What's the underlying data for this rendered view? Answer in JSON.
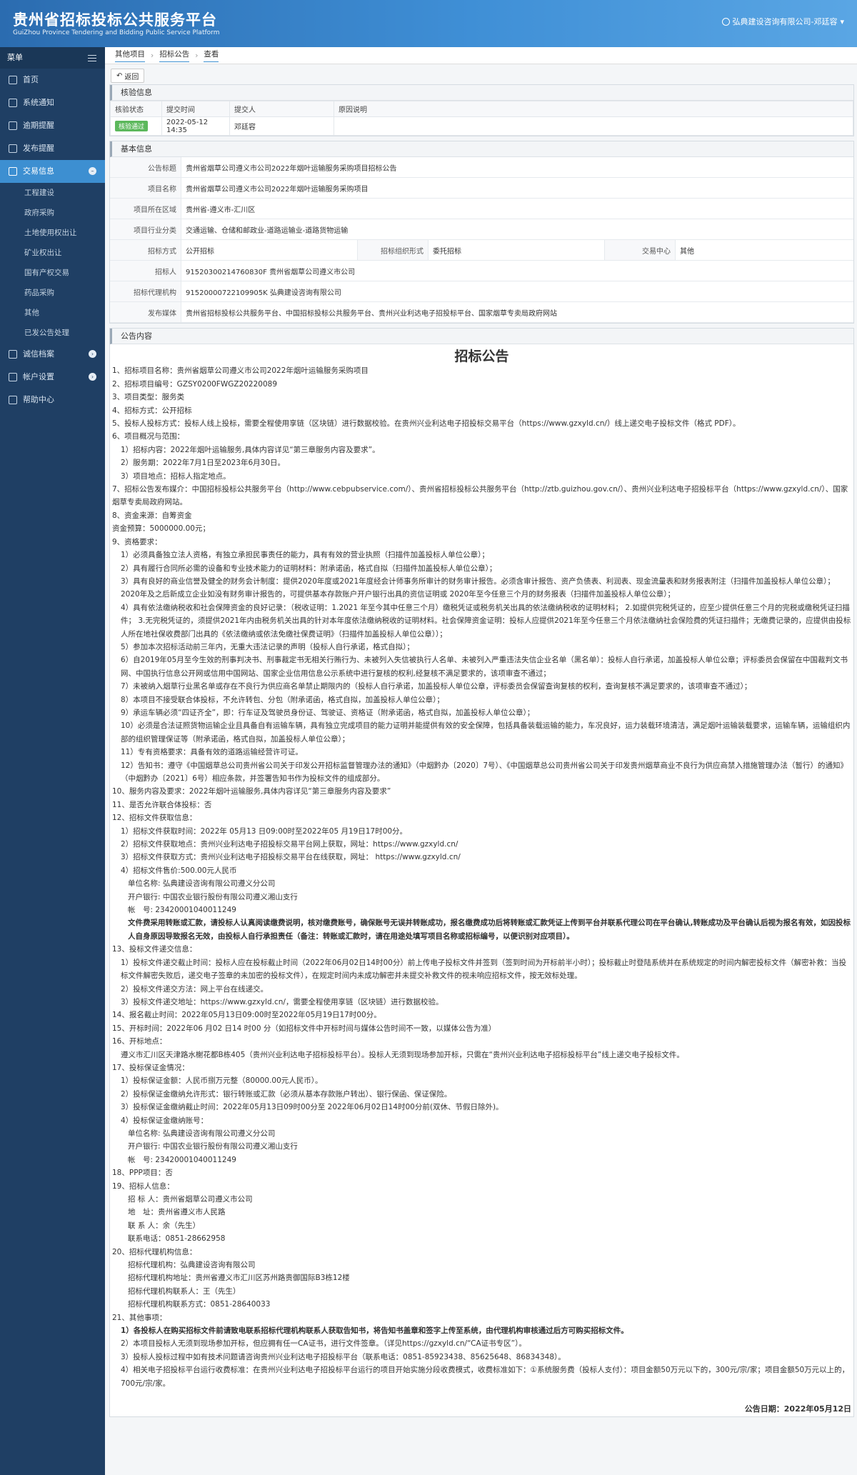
{
  "header": {
    "title": "贵州省招标投标公共服务平台",
    "subtitle": "GuiZhou Province Tendering and Bidding Public Service Platform",
    "user": "弘典建设咨询有限公司-邓廷容"
  },
  "sidebar": {
    "menu_label": "菜单",
    "items": [
      {
        "label": "首页",
        "icon": "home-icon"
      },
      {
        "label": "系统通知",
        "icon": "monitor-icon"
      },
      {
        "label": "逾期提醒",
        "icon": "calendar-icon"
      },
      {
        "label": "发布提醒",
        "icon": "calendar-icon"
      },
      {
        "label": "交易信息",
        "icon": "calendar-icon"
      }
    ],
    "subitems": [
      "工程建设",
      "政府采购",
      "土地使用权出让",
      "矿业权出让",
      "国有产权交易",
      "药品采购",
      "其他",
      "已发公告处理"
    ],
    "bottom": [
      {
        "label": "诚信档案"
      },
      {
        "label": "帐户设置"
      },
      {
        "label": "帮助中心"
      }
    ]
  },
  "breadcrumb": [
    "其他项目",
    "招标公告",
    "查看"
  ],
  "back_label": "返回",
  "check": {
    "title": "核验信息",
    "headers": [
      "核验状态",
      "提交时间",
      "提交人",
      "原因说明"
    ],
    "status": "核验通过",
    "time": "2022-05-12 14:35",
    "person": "邓廷容",
    "reason": ""
  },
  "basic": {
    "title": "基本信息",
    "rows": [
      {
        "label": "公告标题",
        "value": "贵州省烟草公司遵义市公司2022年烟叶运输服务采购项目招标公告"
      },
      {
        "label": "项目名称",
        "value": "贵州省烟草公司遵义市公司2022年烟叶运输服务采购项目"
      },
      {
        "label": "项目所在区域",
        "value": "贵州省-遵义市-汇川区"
      },
      {
        "label": "项目行业分类",
        "value": "交通运输、仓储和邮政业-道路运输业-道路货物运输"
      }
    ],
    "method_label": "招标方式",
    "method": "公开招标",
    "org_label": "招标组织形式",
    "org": "委托招标",
    "center_label": "交易中心",
    "center": "其他",
    "rows2": [
      {
        "label": "招标人",
        "value": "91520300214760830F 贵州省烟草公司遵义市公司"
      },
      {
        "label": "招标代理机构",
        "value": "91520000722109905K 弘典建设咨询有限公司"
      },
      {
        "label": "发布媒体",
        "value": "贵州省招标投标公共服务平台、中国招标投标公共服务平台、贵州兴业利达电子招投标平台、国家烟草专卖局政府网站"
      }
    ]
  },
  "content": {
    "title": "公告内容",
    "heading": "招标公告",
    "date": "公告日期：2022年05月12日"
  },
  "lines": [
    {
      "c": "",
      "t": "1、招标项目名称：贵州省烟草公司遵义市公司2022年烟叶运输服务采购项目"
    },
    {
      "c": "",
      "t": "2、招标项目编号：GZSY0200FWGZ20220089"
    },
    {
      "c": "",
      "t": "3、项目类型：服务类"
    },
    {
      "c": "",
      "t": "4、招标方式：公开招标"
    },
    {
      "c": "",
      "t": "5、投标人投标方式：投标人线上投标，需要全程使用享链（区块链）进行数据校验。在贵州兴业利达电子招投标交易平台（https://www.gzxyld.cn/）线上递交电子投标文件（格式 PDF）。"
    },
    {
      "c": "",
      "t": "6、项目概况与范围："
    },
    {
      "c": "ind1",
      "t": "1）招标内容：2022年烟叶运输服务,具体内容详见“第三章服务内容及要求”。"
    },
    {
      "c": "ind1",
      "t": "2）服务期：2022年7月1日至2023年6月30日。"
    },
    {
      "c": "ind1",
      "t": "3）项目地点：招标人指定地点。"
    },
    {
      "c": "",
      "t": "7、招标公告发布媒介：中国招标投标公共服务平台（http://www.cebpubservice.com/）、贵州省招标投标公共服务平台（http://ztb.guizhou.gov.cn/）、贵州兴业利达电子招投标平台（https://www.gzxyld.cn/）、国家烟草专卖局政府网站。"
    },
    {
      "c": "",
      "t": "8、资金来源：自筹资金"
    },
    {
      "c": "",
      "t": "资金预算：5000000.00元；"
    },
    {
      "c": "",
      "t": "9、资格要求："
    },
    {
      "c": "ind1",
      "t": "1）必须具备独立法人资格，有独立承担民事责任的能力，具有有效的营业执照（扫描件加盖投标人单位公章）；"
    },
    {
      "c": "ind1",
      "t": "2）具有履行合同所必需的设备和专业技术能力的证明材料：附承诺函，格式自拟（扫描件加盖投标人单位公章）；"
    },
    {
      "c": "ind1",
      "t": "3）具有良好的商业信誉及健全的财务会计制度：提供2020年度或2021年度经会计师事务所审计的财务审计报告。必须含审计报告、资产负债表、利润表、现金流量表和财务报表附注（扫描件加盖投标人单位公章）；2020年及之后新成立企业如没有财务审计报告的，可提供基本存款账户开户银行出具的资信证明或 2020年至今任意三个月的财务报表（扫描件加盖投标人单位公章）；"
    },
    {
      "c": "ind1",
      "t": "4）具有依法缴纳税收和社会保障资金的良好记录：（税收证明：1.2021 年至今其中任意三个月）缴税凭证或税务机关出具的依法缴纳税收的证明材料； 2.如提供完税凭证的，应至少提供任意三个月的完税或缴税凭证扫描件； 3.无完税凭证的，须提供2021年内由税务机关出具的针对本年度依法缴纳税收的证明材料。社会保障资金证明：投标人应提供2021年至今任意三个月依法缴纳社会保险费的凭证扫描件；无缴费记录的，应提供由投标人所在地社保收费部门出具的《依法缴纳或依法免缴社保费证明》（扫描件加盖投标人单位公章））；"
    },
    {
      "c": "ind1",
      "t": "5）参加本次招标活动前三年内，无重大违法记录的声明（投标人自行承诺，格式自拟）；"
    },
    {
      "c": "ind1",
      "t": "6）自2019年05月至今生效的刑事判决书、刑事裁定书无相关行贿行为、未被列入失信被执行人名单、未被列入严重违法失信企业名单（黑名单）：投标人自行承诺，加盖投标人单位公章；评标委员会保留在中国裁判文书网、中国执行信息公开网或信用中国网站、国家企业信用信息公示系统中进行复核的权利,经复核不满足要求的，该项审查不通过；"
    },
    {
      "c": "ind1",
      "t": "7）未被纳入烟草行业黑名单或存在不良行为供应商名单禁止期限内的（投标人自行承诺，加盖投标人单位公章，评标委员会保留查询复核的权利，查询复核不满足要求的，该项审查不通过）；"
    },
    {
      "c": "ind1",
      "t": "8）本项目不接受联合体投标，不允许转包、分包（附承诺函，格式自拟，加盖投标人单位公章）；"
    },
    {
      "c": "ind1",
      "t": "9）承运车辆必须“四证齐全”，即：行车证及驾驶员身份证、驾驶证、资格证（附承诺函，格式自拟，加盖投标人单位公章）；"
    },
    {
      "c": "ind1",
      "t": "10）必须是合法证照货物运输企业且具备自有运输车辆，具有独立完成项目的能力证明并能提供有效的安全保障，包括具备装载运输的能力，车况良好，运力装载环境清洁，满足烟叶运输装载要求，运输车辆，运输组织内部的组织管理保证等（附承诺函，格式自拟，加盖投标人单位公章）；"
    },
    {
      "c": "ind1",
      "t": "11）专有资格要求：具备有效的道路运输经营许可证。"
    },
    {
      "c": "ind1",
      "t": "12）告知书：遵守《中国烟草总公司贵州省公司关于印发公开招标监督管理办法的通知》（中烟黔办〔2020〕7号）、《中国烟草总公司贵州省公司关于印发贵州烟草商业不良行为供应商禁入措施管理办法（暂行）的通知》（中烟黔办〔2021〕6号）相应条款，并签署告知书作为投标文件的组成部分。"
    },
    {
      "c": "",
      "t": "10、服务内容及要求：2022年烟叶运输服务,具体内容详见“第三章服务内容及要求”"
    },
    {
      "c": "",
      "t": "11、是否允许联合体投标：否"
    },
    {
      "c": "",
      "t": "12、招标文件获取信息："
    },
    {
      "c": "ind1",
      "t": "1）招标文件获取时间：2022年 05月13 日09:00时至2022年05 月19日17时00分。"
    },
    {
      "c": "ind1",
      "t": "2）招标文件获取地点：贵州兴业利达电子招投标交易平台网上获取，网址：https://www.gzxyld.cn/"
    },
    {
      "c": "ind1",
      "t": "3）招标文件获取方式：贵州兴业利达电子招投标交易平台在线获取，网址： https://www.gzxyld.cn/"
    },
    {
      "c": "ind1",
      "t": "4）招标文件售价:500.00元人民币"
    },
    {
      "c": "ind2",
      "t": "单位名称: 弘典建设咨询有限公司遵义分公司"
    },
    {
      "c": "ind2",
      "t": "开户银行: 中国农业银行股份有限公司遵义湘山支行"
    },
    {
      "c": "ind2",
      "t": "帐　号: 23420001040011249"
    },
    {
      "c": "ind2 b",
      "t": "文件费采用转账或汇款，请投标人认真阅读缴费说明，核对缴费账号，确保账号无误并转账成功，报名缴费成功后将转账或汇款凭证上传到平台并联系代理公司在平台确认,转账成功及平台确认后视为报名有效，如因投标人自身原因导致报名无效，由投标人自行承担责任（备注：转账或汇款时，请在用途处填写项目名称或招标编号，以便识别对应项目）。"
    },
    {
      "c": "",
      "t": "13、投标文件递交信息："
    },
    {
      "c": "ind1",
      "t": "1）投标文件递交截止时间：投标人应在投标截止时间（2022年06月02日14时00分）前上传电子投标文件并签到（签到时间为开标前半小时）；投标截止时登陆系统并在系统规定的时间内解密投标文件（解密补救：当投标文件解密失败后，递交电子签章的未加密的投标文件），在规定时间内未成功解密并未提交补救文件的视未响应招标文件，按无效标处理。"
    },
    {
      "c": "ind1",
      "t": "2）投标文件递交方法：网上平台在线递交。"
    },
    {
      "c": "ind1",
      "t": "3）投标文件递交地址：https://www.gzxyld.cn/，需要全程使用享链（区块链）进行数据校验。"
    },
    {
      "c": "",
      "t": "14、报名截止时间：2022年05月13日09:00时至2022年05月19日17时00分。"
    },
    {
      "c": "",
      "t": "15、开标时间：2022年06 月02 日14 时00 分（如招标文件中开标时间与媒体公告时间不一致，以媒体公告为准）"
    },
    {
      "c": "",
      "t": "16、开标地点："
    },
    {
      "c": "ind1",
      "t": "遵义市汇川区天津路水榭花都B栋405（贵州兴业利达电子招标投标平台）。投标人无须到现场参加开标，只需在“贵州兴业利达电子招标投标平台”线上递交电子投标文件。"
    },
    {
      "c": "",
      "t": "17、投标保证金情况："
    },
    {
      "c": "ind1",
      "t": "1）投标保证金额：人民币捌万元整（80000.00元人民币）。"
    },
    {
      "c": "ind1",
      "t": "2）投标保证金缴纳允许形式：银行转账或汇款（必须从基本存款账户转出）、银行保函、保证保险。"
    },
    {
      "c": "ind1",
      "t": "3）投标保证金缴纳截止时间：2022年05月13日09时00分至 2022年06月02日14时00分前(双休、节假日除外)。"
    },
    {
      "c": "ind1",
      "t": "4）投标保证金缴纳账号："
    },
    {
      "c": "ind2",
      "t": "单位名称: 弘典建设咨询有限公司遵义分公司"
    },
    {
      "c": "ind2",
      "t": "开户银行: 中国农业银行股份有限公司遵义湘山支行"
    },
    {
      "c": "ind2",
      "t": "帐　号: 23420001040011249"
    },
    {
      "c": "",
      "t": "18、PPP项目：否"
    },
    {
      "c": "",
      "t": "19、招标人信息："
    },
    {
      "c": "ind2",
      "t": "招 标 人：贵州省烟草公司遵义市公司"
    },
    {
      "c": "ind2",
      "t": "地　址：贵州省遵义市人民路"
    },
    {
      "c": "ind2",
      "t": "联 系 人：余（先生）"
    },
    {
      "c": "ind2",
      "t": "联系电话：0851-28662958"
    },
    {
      "c": "",
      "t": "20、招标代理机构信息："
    },
    {
      "c": "ind2",
      "t": "招标代理机构：弘典建设咨询有限公司"
    },
    {
      "c": "ind2",
      "t": "招标代理机构地址：贵州省遵义市汇川区苏州路贵御国际B3栋12楼"
    },
    {
      "c": "ind2",
      "t": "招标代理机构联系人：王（先生）"
    },
    {
      "c": "ind2",
      "t": "招标代理机构联系方式：0851-28640033"
    },
    {
      "c": "",
      "t": "21、其他事项："
    },
    {
      "c": "ind1 b",
      "t": "1）各投标人在购买招标文件前请致电联系招标代理机构联系人获取告知书，将告知书盖章和签字上传至系统，由代理机构审核通过后方可购买招标文件。"
    },
    {
      "c": "",
      "t": " "
    },
    {
      "c": "ind1",
      "t": "2）本项目投标人无须到现场参加开标，但应拥有任一CA证书，进行文件签章。（详见https://gzxyld.cn/“CA证书专区”）。"
    },
    {
      "c": "ind1",
      "t": "3）投标人投标过程中如有技术问题请咨询贵州兴业利达电子招投标平台（联系电话：0851-85923438、85625648、86834348）。"
    },
    {
      "c": "ind1",
      "t": "4）相关电子招投标平台运行收费标准：在贵州兴业利达电子招投标平台运行的项目开始实施分段收费模式，收费标准如下：①系统服务费（投标人支付）：项目金额50万元以下的，300元/宗/家；项目金额50万元以上的，700元/宗/家。"
    }
  ]
}
